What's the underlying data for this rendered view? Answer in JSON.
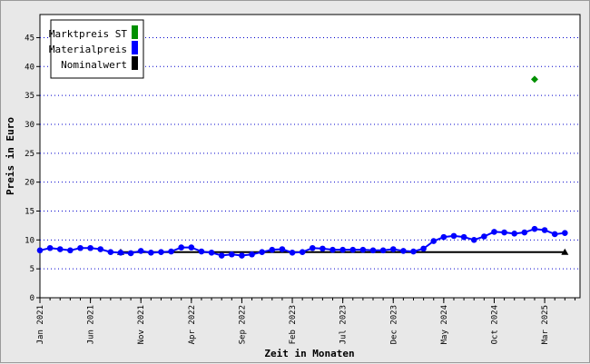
{
  "chart_data": {
    "type": "line",
    "xlabel": "Zeit in Monaten",
    "ylabel": "Preis in Euro",
    "ylim": [
      0,
      49
    ],
    "yticks": [
      0,
      5,
      10,
      15,
      20,
      25,
      30,
      35,
      40,
      45
    ],
    "grid": "horizontal dotted",
    "legend_position": "top-left",
    "x_tick_labels": [
      {
        "month": 0,
        "label": "Jan 2021"
      },
      {
        "month": 5,
        "label": "Jun 2021"
      },
      {
        "month": 10,
        "label": "Nov 2021"
      },
      {
        "month": 15,
        "label": "Apr 2022"
      },
      {
        "month": 20,
        "label": "Sep 2022"
      },
      {
        "month": 25,
        "label": "Feb 2023"
      },
      {
        "month": 30,
        "label": "Jul 2023"
      },
      {
        "month": 35,
        "label": "Dec 2023"
      },
      {
        "month": 40,
        "label": "May 2024"
      },
      {
        "month": 45,
        "label": "Oct 2024"
      },
      {
        "month": 50,
        "label": "Mar 2025"
      }
    ],
    "series": [
      {
        "name": "Marktpreis ST",
        "color": "#009000",
        "marker": "diamond",
        "points": [
          [
            49,
            37.8
          ]
        ]
      },
      {
        "name": "Materialpreis",
        "color": "#0000ff",
        "marker": "circle",
        "points": [
          [
            0,
            8.2
          ],
          [
            1,
            8.6
          ],
          [
            2,
            8.4
          ],
          [
            3,
            8.2
          ],
          [
            4,
            8.6
          ],
          [
            5,
            8.6
          ],
          [
            6,
            8.4
          ],
          [
            7,
            7.9
          ],
          [
            8,
            7.8
          ],
          [
            9,
            7.7
          ],
          [
            10,
            8.1
          ],
          [
            11,
            7.8
          ],
          [
            12,
            7.9
          ],
          [
            13,
            8.0
          ],
          [
            14,
            8.7
          ],
          [
            15,
            8.7
          ],
          [
            16,
            8.0
          ],
          [
            17,
            7.8
          ],
          [
            18,
            7.3
          ],
          [
            19,
            7.5
          ],
          [
            20,
            7.3
          ],
          [
            21,
            7.5
          ],
          [
            22,
            7.9
          ],
          [
            23,
            8.3
          ],
          [
            24,
            8.4
          ],
          [
            25,
            7.8
          ],
          [
            26,
            7.9
          ],
          [
            27,
            8.6
          ],
          [
            28,
            8.5
          ],
          [
            29,
            8.3
          ],
          [
            30,
            8.3
          ],
          [
            31,
            8.3
          ],
          [
            32,
            8.3
          ],
          [
            33,
            8.2
          ],
          [
            34,
            8.2
          ],
          [
            35,
            8.4
          ],
          [
            36,
            8.1
          ],
          [
            37,
            8.0
          ],
          [
            38,
            8.5
          ],
          [
            39,
            9.8
          ],
          [
            40,
            10.5
          ],
          [
            41,
            10.7
          ],
          [
            42,
            10.5
          ],
          [
            43,
            10.0
          ],
          [
            44,
            10.6
          ],
          [
            45,
            11.4
          ],
          [
            46,
            11.3
          ],
          [
            47,
            11.1
          ],
          [
            48,
            11.3
          ],
          [
            49,
            11.9
          ],
          [
            50,
            11.7
          ],
          [
            51,
            11.0
          ],
          [
            52,
            11.2
          ]
        ]
      },
      {
        "name": "Nominalwert",
        "color": "#000000",
        "marker": "triangle",
        "points": [
          [
            8,
            7.9
          ],
          [
            52,
            7.9
          ]
        ]
      }
    ]
  }
}
